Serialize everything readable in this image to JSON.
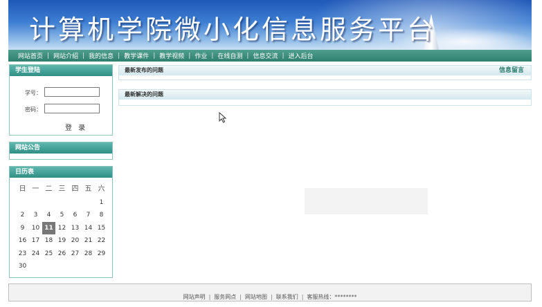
{
  "banner": {
    "title": "计算机学院微小化信息服务平台"
  },
  "nav": {
    "items": [
      "网站首页",
      "网站介绍",
      "我的信息",
      "教学课件",
      "教学视频",
      "作业",
      "在线自测",
      "信息交流",
      "进入后台"
    ],
    "separator": "|"
  },
  "login": {
    "title": "学生登陆",
    "student_id_label": "学号：",
    "password_label": "密码：",
    "student_id_value": "",
    "password_value": "",
    "submit_label": "登 录"
  },
  "notice": {
    "title": "网站公告"
  },
  "calendar": {
    "title": "日历表",
    "weekdays": [
      "日",
      "一",
      "二",
      "三",
      "四",
      "五",
      "六"
    ],
    "days": [
      "",
      "",
      "",
      "",
      "",
      "",
      "1",
      "2",
      "3",
      "4",
      "5",
      "6",
      "7",
      "8",
      "9",
      "10",
      "11",
      "12",
      "13",
      "14",
      "15",
      "16",
      "17",
      "18",
      "19",
      "20",
      "21",
      "22",
      "23",
      "24",
      "25",
      "26",
      "27",
      "28",
      "29",
      "30"
    ],
    "today": "11"
  },
  "main": {
    "latest_posted_title": "最新发布的问题",
    "message_link": "信息留言",
    "latest_solved_title": "最新解决的问题"
  },
  "footer": {
    "links": [
      "网站声明",
      "服务网点",
      "网站地图",
      "联系我们"
    ],
    "hotline_label": "客服热线：********"
  },
  "colors": {
    "nav": "#2f7f6f",
    "panel_head": "#2f8f85",
    "banner": "#3e7fd3"
  }
}
